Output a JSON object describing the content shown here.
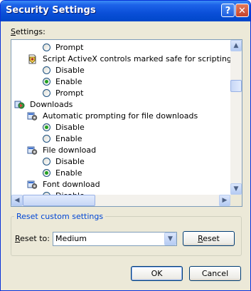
{
  "window": {
    "title": "Security Settings",
    "help_glyph": "?",
    "close_glyph": "✕"
  },
  "settings_label": {
    "underlined": "S",
    "rest": "ettings:"
  },
  "tree": [
    {
      "type": "radio",
      "label": "Prompt",
      "checked": false
    },
    {
      "type": "setting",
      "label": "Script ActiveX controls marked safe for scripting",
      "icon": "activex-script-icon"
    },
    {
      "type": "radio",
      "label": "Disable",
      "checked": false
    },
    {
      "type": "radio",
      "label": "Enable",
      "checked": true
    },
    {
      "type": "radio",
      "label": "Prompt",
      "checked": false
    },
    {
      "type": "category",
      "label": "Downloads",
      "icon": "downloads-category-icon"
    },
    {
      "type": "setting",
      "label": "Automatic prompting for file downloads",
      "icon": "settings-gear-icon"
    },
    {
      "type": "radio",
      "label": "Disable",
      "checked": true
    },
    {
      "type": "radio",
      "label": "Enable",
      "checked": false
    },
    {
      "type": "setting",
      "label": "File download",
      "icon": "settings-gear-icon"
    },
    {
      "type": "radio",
      "label": "Disable",
      "checked": false
    },
    {
      "type": "radio",
      "label": "Enable",
      "checked": true
    },
    {
      "type": "setting",
      "label": "Font download",
      "icon": "settings-gear-icon"
    },
    {
      "type": "radio",
      "label": "Disable",
      "checked": false
    }
  ],
  "reset_group": {
    "title": "Reset custom settings",
    "reset_to_label_u": "R",
    "reset_to_label_rest": "eset to:",
    "selected": "Medium",
    "reset_button_u": "R",
    "reset_button_rest": "eset"
  },
  "buttons": {
    "ok": "OK",
    "cancel": "Cancel"
  },
  "colors": {
    "titlebar": "#0a4fd8",
    "group_title": "#0046d5",
    "radio_dot": "#21a121",
    "dialog_bg": "#ece9d8"
  }
}
